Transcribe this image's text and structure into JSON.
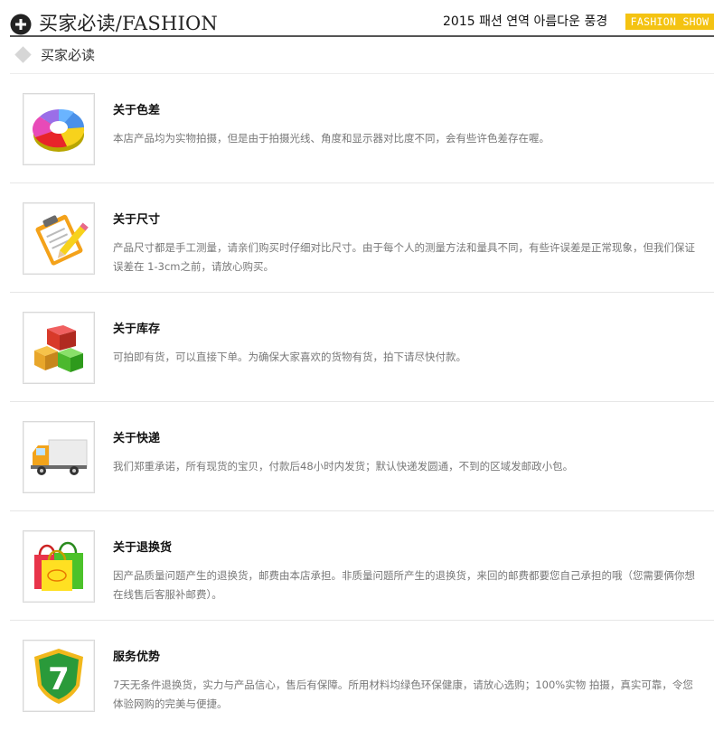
{
  "header": {
    "title": "买家必读/FASHION",
    "tagline": "2015 패션 연역 아름다운 풍경",
    "badge": "FASHION SHOW"
  },
  "section": {
    "title": "买家必读"
  },
  "items": [
    {
      "title": "关于色差",
      "description": "本店产品均为实物拍摄，但是由于拍摄光线、角度和显示器对比度不同，会有些许色差存在喔。",
      "icon": "color-wheel-icon"
    },
    {
      "title": "关于尺寸",
      "description": "产品尺寸都是手工测量，请亲们购买时仔细对比尺寸。由于每个人的测量方法和量具不同，有些许误差是正常现象，但我们保证误差在 1-3cm之前，请放心购买。",
      "icon": "clipboard-pencil-icon"
    },
    {
      "title": "关于库存",
      "description": "可拍即有货，可以直接下单。为确保大家喜欢的货物有货，拍下请尽快付款。",
      "icon": "stock-boxes-icon"
    },
    {
      "title": "关于快递",
      "description": "我们郑重承诺，所有现货的宝贝，付款后48小时内发货；默认快递发圆通，不到的区域发邮政小包。",
      "icon": "delivery-truck-icon"
    },
    {
      "title": "关于退换货",
      "description": "因产品质量问题产生的退换货，邮费由本店承担。非质量问题所产生的退换货，来回的邮费都要您自己承担的哦（您需要俩你想在线售后客服补邮费）。",
      "icon": "shopping-bags-icon"
    },
    {
      "title": "服务优势",
      "description": "7天无条件退换货，实力与产品信心，售后有保障。所用材料均绿色环保健康，请放心选购；100%实物 拍摄，真实可靠，令您体验网购的完美与便捷。",
      "icon": "seven-day-shield-icon",
      "icon_text": "7"
    }
  ]
}
